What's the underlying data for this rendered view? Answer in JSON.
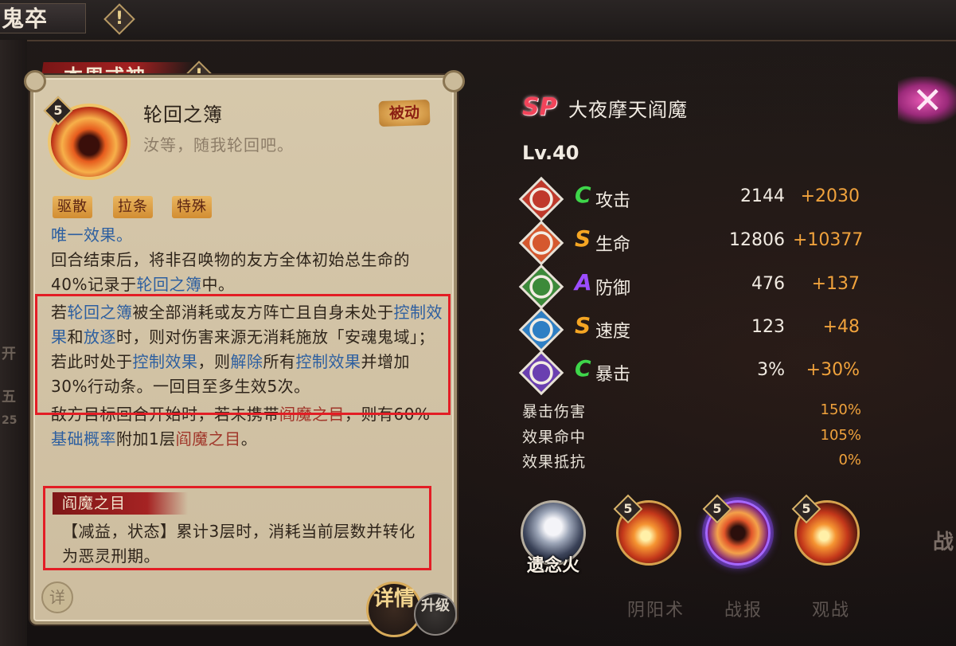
{
  "topbar": {
    "title": "鬼卒",
    "alert_glyph": "!"
  },
  "left_edge": {
    "ghost1": "开",
    "ghost2": "五",
    "ghost3": "25"
  },
  "panel": {
    "tab_label": "本周式神",
    "tab_alert": "!",
    "skill": {
      "level": "5",
      "name": "轮回之簿",
      "quote": "汝等，随我轮回吧。",
      "type_badge": "被动",
      "tags": [
        "驱散",
        "拉条",
        "特殊"
      ]
    },
    "desc": {
      "l1": "唯一效果。",
      "l2a": "回合结束后，将非召唤物的友方全体初始总生命的40%记录于",
      "l2kw": "轮回之簿",
      "l2b": "中。",
      "l3a": "若",
      "l3kw1": "轮回之簿",
      "l3b": "被全部消耗或友方阵亡且自身未处于",
      "l3kw2": "控制效果",
      "l3c": "和",
      "l3kw3": "放逐",
      "l3d": "时，则对伤害来源无消耗施放「安魂鬼域」；若此时处于",
      "l3kw4": "控制效果",
      "l3e": "，则",
      "l3kw5": "解除",
      "l3f": "所有",
      "l3kw6": "控制效果",
      "l3g": "并增加30%行动条。一回目至多生效5次。",
      "l4a": "敌方目标回合开始时，若未携带",
      "l4kw1": "阎魔之目",
      "l4b": "，则有60%",
      "l4kw2": "基础概率",
      "l4c": "附加1层",
      "l4kw3": "阎魔之目",
      "l4d": "。"
    },
    "effect": {
      "title": "阎魔之目",
      "text": "【减益，状态】累计3层时，消耗当前层数并转化为恶灵刑期。"
    },
    "detail_button": "详"
  },
  "tabs": {
    "details": "详情",
    "upgrade": "升级"
  },
  "bottom_ghost": {
    "left": "阴阳术",
    "mid": "战报",
    "right": "观战"
  },
  "shikigami": {
    "rarity": "SP",
    "name": "大夜摩天阎魔",
    "level": "Lv.40"
  },
  "stats": [
    {
      "grade": "C",
      "grade_color": "#3ed64a",
      "label": "攻击",
      "base": "2144",
      "bonus": "+2030",
      "icon_color": "#c0392b"
    },
    {
      "grade": "S",
      "grade_color": "#f5a623",
      "label": "生命",
      "base": "12806",
      "bonus": "+10377",
      "icon_color": "#d5582e"
    },
    {
      "grade": "A",
      "grade_color": "#9b4dff",
      "label": "防御",
      "base": "476",
      "bonus": "+137",
      "icon_color": "#3c8a3a"
    },
    {
      "grade": "S",
      "grade_color": "#f5a623",
      "label": "速度",
      "base": "123",
      "bonus": "+48",
      "icon_color": "#2e7fc4"
    },
    {
      "grade": "C",
      "grade_color": "#3ed64a",
      "label": "暴击",
      "base": "3%",
      "bonus": "+30%",
      "icon_color": "#6a3fb0"
    }
  ],
  "sub_stats": [
    {
      "label": "暴击伤害",
      "value": "150%"
    },
    {
      "label": "效果命中",
      "value": "105%"
    },
    {
      "label": "效果抵抗",
      "value": "0%"
    }
  ],
  "soul": {
    "label": "遗念火"
  },
  "skill_orbs": [
    {
      "level": "5"
    },
    {
      "level": "5"
    },
    {
      "level": "5"
    }
  ],
  "close_glyph": "✕",
  "right_ghost": "战"
}
